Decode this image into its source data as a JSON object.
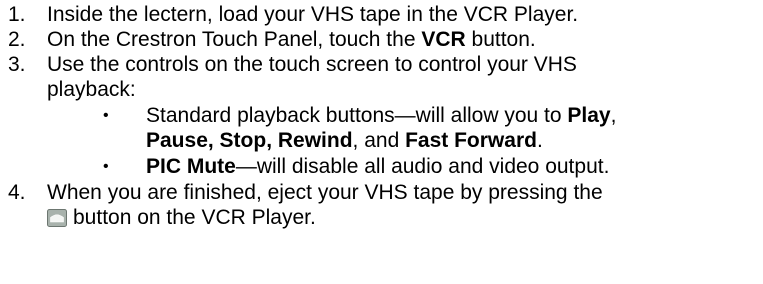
{
  "steps": [
    {
      "number": "1.",
      "text": "Inside the lectern, load your VHS tape in the VCR Player."
    },
    {
      "number": "2.",
      "text_before": "On the Crestron Touch Panel, touch the ",
      "bold": "VCR",
      "text_after": " button."
    },
    {
      "number": "3.",
      "line1": "Use the controls on the touch screen to control your VHS",
      "line2": "playback:",
      "bullets": [
        {
          "bullet": "•",
          "line1_before": "Standard playback buttons—will allow you to ",
          "line1_bold": "Play",
          "line1_after": ",",
          "line2_bold1": "Pause",
          "line2_sep1": ", ",
          "line2_bold2": "Stop",
          "line2_sep2": ", ",
          "line2_bold3": "Rewind",
          "line2_sep3": ", and ",
          "line2_bold4": "Fast Forward",
          "line2_end": "."
        },
        {
          "bullet": "•",
          "bold": "PIC Mute",
          "text": "—will disable all audio and video output."
        }
      ]
    },
    {
      "number": "4.",
      "line1": "When you are finished, eject your VHS tape by pressing the",
      "icon": "eject-button-icon",
      "line2": "button on the VCR Player."
    }
  ]
}
